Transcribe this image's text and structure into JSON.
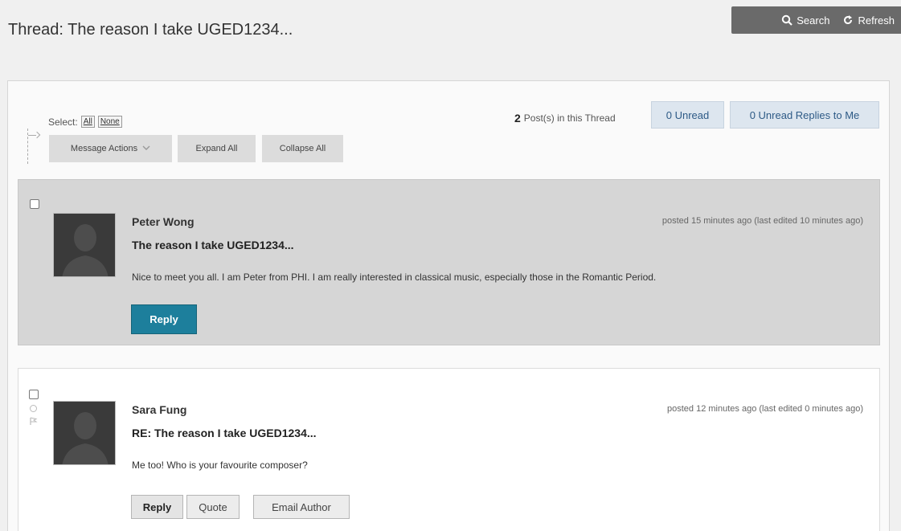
{
  "toolbar": {
    "search_label": "Search",
    "refresh_label": "Refresh"
  },
  "page": {
    "title": "Thread: The reason I take UGED1234..."
  },
  "controls": {
    "select_label": "Select:",
    "select_all": "All",
    "select_none": "None",
    "message_actions": "Message Actions",
    "expand_all": "Expand All",
    "collapse_all": "Collapse All"
  },
  "stats": {
    "post_count": "2",
    "post_count_suffix": "Post(s) in this Thread",
    "unread": "0 Unread",
    "unread_replies": "0 Unread Replies to Me"
  },
  "posts": [
    {
      "author": "Peter Wong",
      "subject": "The reason I take UGED1234...",
      "body": "Nice to meet you all. I am Peter from PHI. I am really interested in classical music, especially those in the Romantic Period.",
      "posted": "posted 15 minutes ago (last edited 10 minutes ago)",
      "reply_label": "Reply"
    },
    {
      "author": "Sara Fung",
      "subject": "RE: The reason I take UGED1234...",
      "body": "Me too! Who is your favourite composer?",
      "posted": "posted 12 minutes ago (last edited 0 minutes ago)",
      "reply_label": "Reply",
      "quote_label": "Quote",
      "email_label": "Email Author"
    }
  ],
  "colors": {
    "accent": "#1d7f9c",
    "toolbar_bg": "#6a6a6a",
    "selected_post_bg": "#d6d6d6"
  }
}
